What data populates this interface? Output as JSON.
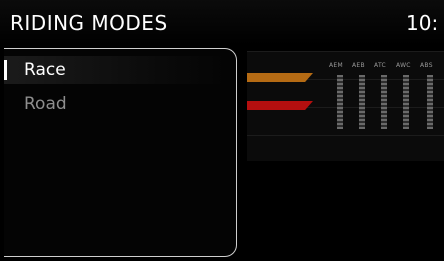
{
  "header": {
    "title": "RIDING MODES",
    "clock": "10:"
  },
  "modes": [
    {
      "label": "Race",
      "selected": true
    },
    {
      "label": "Road",
      "selected": false
    }
  ],
  "settings_columns": [
    "AEM",
    "AEB",
    "ATC",
    "AWC",
    "ABS"
  ],
  "colors": {
    "background": "#000000",
    "selected_text": "#ffffff",
    "unselected_text": "#8e8e8e",
    "orange_bar": "#b56b14",
    "red_bar": "#b50f0f"
  }
}
